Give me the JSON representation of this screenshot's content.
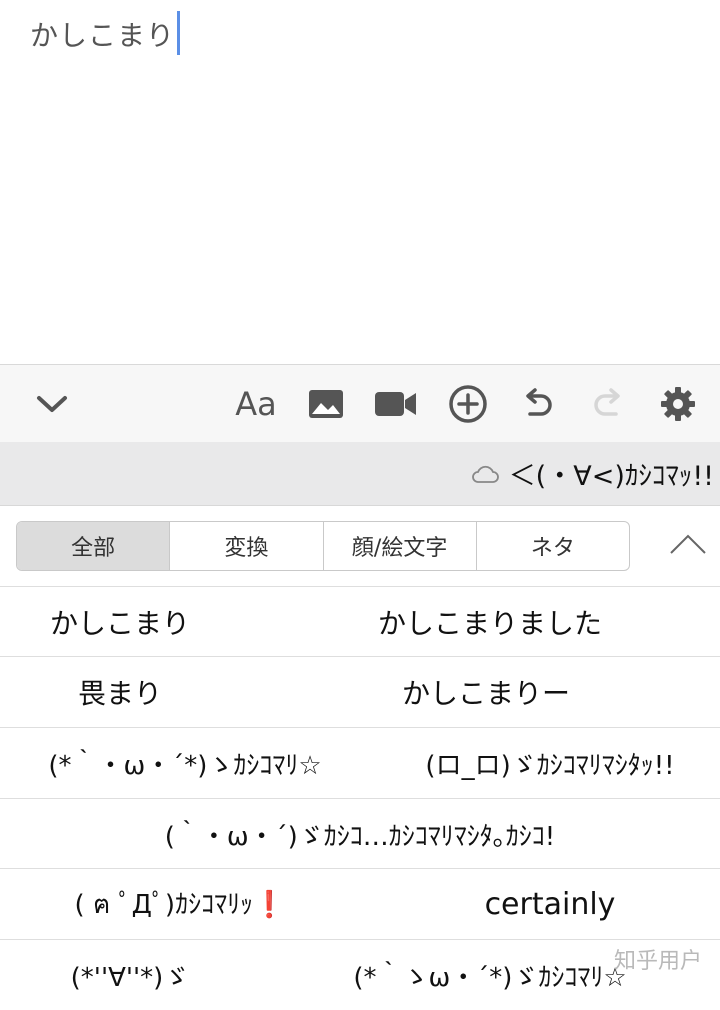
{
  "editor": {
    "text": "かしこまり"
  },
  "toolbar": {
    "font_label": "Aa"
  },
  "prediction": {
    "text": "＜(・∀<)ｶｼｺﾏｯ!!"
  },
  "tabs": [
    {
      "label": "全部",
      "active": true
    },
    {
      "label": "変換",
      "active": false
    },
    {
      "label": "顔/絵文字",
      "active": false
    },
    {
      "label": "ネタ",
      "active": false
    }
  ],
  "candidates": {
    "r1": {
      "left": "かしこまり",
      "right": "かしこまりました"
    },
    "r2": {
      "left": "畏まり",
      "right": "かしこまりー"
    },
    "r3": {
      "left": "(*｀・ω・´*)ゝｶｼｺﾏﾘ☆",
      "right": "(ロ_ロ)ゞｶｼｺﾏﾘﾏｼﾀｯ!!"
    },
    "r4": {
      "full": "(｀・ω・´)ゞｶｼｺ…ｶｼｺﾏﾘﾏｼﾀ｡ｶｼｺ!"
    },
    "r5": {
      "left": "( ฅ ﾟДﾟ)ｶｼｺﾏﾘｯ❗",
      "right": "certainly"
    },
    "r6": {
      "left": "(*''∀''*)ゞ",
      "right": "(*｀ゝω・´*)ゞｶｼｺﾏﾘ☆"
    }
  },
  "watermark": "知乎用户",
  "colors": {
    "caret": "#5b8fe6",
    "accent_red": "#d42a2a",
    "active_tab": "#dcdcdc"
  }
}
